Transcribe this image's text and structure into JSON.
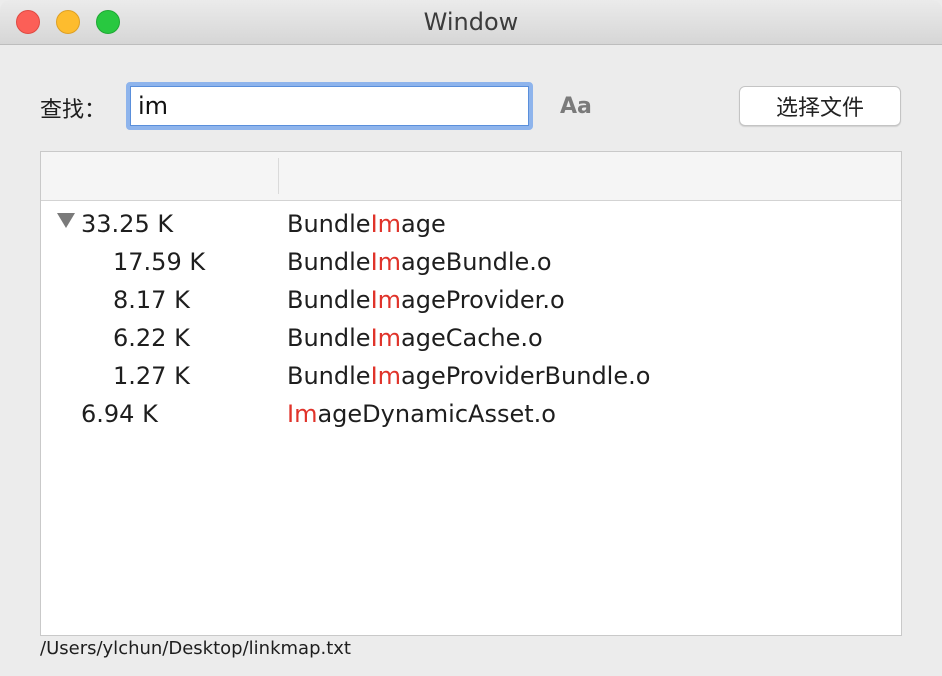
{
  "window": {
    "title": "Window"
  },
  "search": {
    "label": "查找：",
    "value": "im",
    "case_toggle_label": "Aa"
  },
  "toolbar": {
    "choose_file_label": "选择文件"
  },
  "table": {
    "headers": [
      "",
      ""
    ],
    "rows": [
      {
        "size": "33.25 K",
        "name_pre": "Bundle",
        "name_match": "Im",
        "name_post": "age",
        "expanded": true,
        "level": 0
      },
      {
        "size": "17.59 K",
        "name_pre": "Bundle",
        "name_match": "Im",
        "name_post": "ageBundle.o",
        "level": 1
      },
      {
        "size": "8.17 K",
        "name_pre": "Bundle",
        "name_match": "Im",
        "name_post": "ageProvider.o",
        "level": 1
      },
      {
        "size": "6.22 K",
        "name_pre": "Bundle",
        "name_match": "Im",
        "name_post": "ageCache.o",
        "level": 1
      },
      {
        "size": "1.27 K",
        "name_pre": "Bundle",
        "name_match": "Im",
        "name_post": "ageProviderBundle.o",
        "level": 1
      },
      {
        "size": "6.94 K",
        "name_pre": "",
        "name_match": "Im",
        "name_post": "ageDynamicAsset.o",
        "level": 0
      }
    ]
  },
  "status": {
    "path": "/Users/ylchun/Desktop/linkmap.txt"
  },
  "colors": {
    "match_highlight": "#e0332a",
    "focus_ring": "#8eb4ec",
    "close": "#fc5f57",
    "minimize": "#fdbc2e",
    "zoom": "#28c840"
  },
  "icons": {
    "disclosure": "disclosure-triangle-down-icon"
  }
}
